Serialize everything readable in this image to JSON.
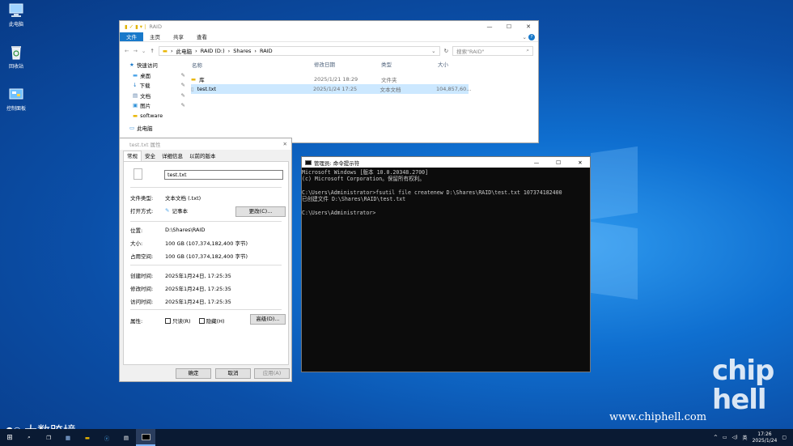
{
  "desktop": {
    "icons": [
      {
        "label": "此电脑",
        "icon": "computer-icon"
      },
      {
        "label": "回收站",
        "icon": "recycle-bin-icon"
      },
      {
        "label": "控制面板",
        "icon": "control-panel-icon"
      }
    ],
    "watermark_left": "大数跨境",
    "watermark_url": "www.chiphell.com",
    "logo_text": "chip hell"
  },
  "explorer": {
    "title": "RAID",
    "ribbon_tabs": [
      "文件",
      "主页",
      "共享",
      "查看"
    ],
    "breadcrumb": [
      "此电脑",
      "RAID (D:)",
      "Shares",
      "RAID"
    ],
    "search_placeholder": "搜索\"RAID\"",
    "nav": [
      {
        "label": "快速访问",
        "icon": "star-icon"
      },
      {
        "label": "桌面",
        "icon": "desktop-folder-icon"
      },
      {
        "label": "下载",
        "icon": "download-icon"
      },
      {
        "label": "文档",
        "icon": "documents-icon"
      },
      {
        "label": "图片",
        "icon": "pictures-icon"
      },
      {
        "label": "software",
        "icon": "folder-icon"
      },
      {
        "label": "此电脑",
        "icon": "computer-icon"
      }
    ],
    "columns": [
      "名称",
      "修改日期",
      "类型",
      "大小"
    ],
    "rows": [
      {
        "name": "库",
        "date": "2025/1/21 18:29",
        "type": "文件夹",
        "size": ""
      },
      {
        "name": "test.txt",
        "date": "2025/1/24 17:25",
        "type": "文本文档",
        "size": "104,857,60..."
      }
    ]
  },
  "properties": {
    "title": "test.txt 属性",
    "tabs": [
      "常规",
      "安全",
      "详细信息",
      "以前的版本"
    ],
    "filename": "test.txt",
    "file_type_label": "文件类型:",
    "file_type": "文本文档 (.txt)",
    "open_with_label": "打开方式:",
    "open_with": "记事本",
    "change_button": "更改(C)...",
    "location_label": "位置:",
    "location": "D:\\Shares\\RAID",
    "size_label": "大小:",
    "size": "100 GB (107,374,182,400 字节)",
    "disk_size_label": "占用空间:",
    "disk_size": "100 GB (107,374,182,400 字节)",
    "created_label": "创建时间:",
    "created": "2025年1月24日, 17:25:35",
    "modified_label": "修改时间:",
    "modified": "2025年1月24日, 17:25:35",
    "accessed_label": "访问时间:",
    "accessed": "2025年1月24日, 17:25:35",
    "attributes_label": "属性:",
    "readonly": "只读(R)",
    "hidden": "隐藏(H)",
    "advanced_button": "高级(D)...",
    "ok": "确定",
    "cancel": "取消",
    "apply": "应用(A)"
  },
  "cmd": {
    "title": "管理员: 命令提示符",
    "lines": [
      "Microsoft Windows [版本 10.0.20348.2700]",
      "(c) Microsoft Corporation。保留所有权利。",
      "",
      "C:\\Users\\Administrator>fsutil file createnew D:\\Shares\\RAID\\test.txt 107374182400",
      "已创建文件 D:\\Shares\\RAID\\test.txt",
      "",
      "C:\\Users\\Administrator>"
    ]
  },
  "taskbar": {
    "ime": "英",
    "time": "17:26",
    "date": "2025/1/24"
  },
  "colors": {
    "accent": "#1979ca",
    "selection": "#cce8ff",
    "console_bg": "#0c0c0c",
    "taskbar": "#0a1a33"
  }
}
